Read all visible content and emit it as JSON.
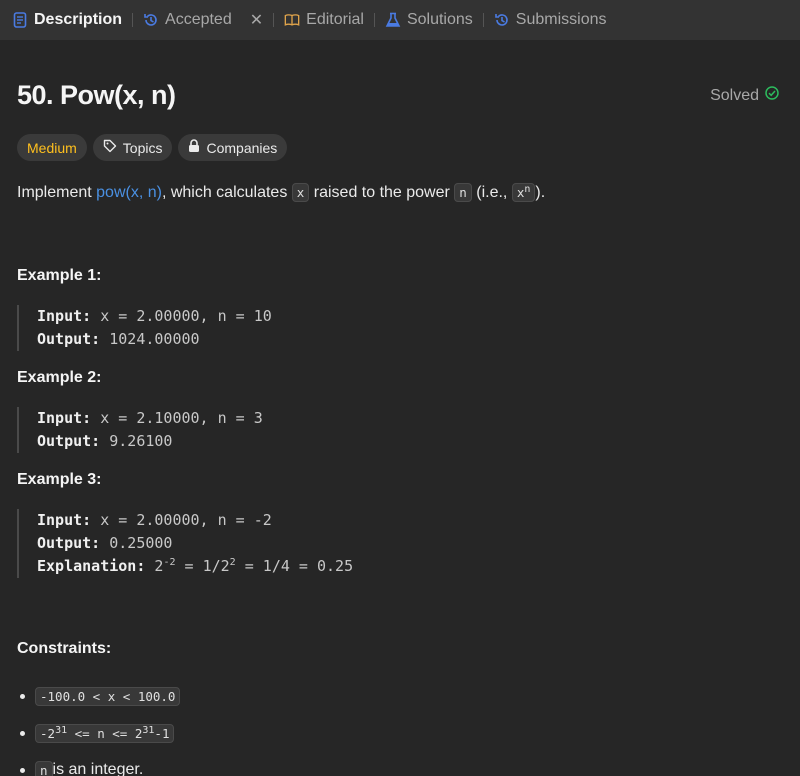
{
  "tabs": {
    "description": "Description",
    "accepted": "Accepted",
    "editorial": "Editorial",
    "solutions": "Solutions",
    "submissions": "Submissions"
  },
  "problem": {
    "title": "50. Pow(x, n)",
    "status": "Solved",
    "difficulty": "Medium",
    "topics_label": "Topics",
    "companies_label": "Companies"
  },
  "description": {
    "prefix": "Implement ",
    "link": "pow(x, n)",
    "mid1": ", which calculates ",
    "code_x": "x",
    "mid2": " raised to the power ",
    "code_n": "n",
    "mid3": " (i.e., ",
    "code_xn_base": "x",
    "code_xn_exp": "n",
    "suffix": ")."
  },
  "examples": [
    {
      "title": "Example 1:",
      "input_label": "Input:",
      "input": "x = 2.00000, n = 10",
      "output_label": "Output:",
      "output": "1024.00000"
    },
    {
      "title": "Example 2:",
      "input_label": "Input:",
      "input": "x = 2.10000, n = 3",
      "output_label": "Output:",
      "output": "9.26100"
    },
    {
      "title": "Example 3:",
      "input_label": "Input:",
      "input": "x = 2.00000, n = -2",
      "output_label": "Output:",
      "output": "0.25000",
      "explanation_label": "Explanation:",
      "explanation_a": "2",
      "explanation_a_exp": "-2",
      "explanation_b": " = 1/2",
      "explanation_b_exp": "2",
      "explanation_c": " = 1/4 = 0.25"
    }
  ],
  "constraints": {
    "title": "Constraints:",
    "c1": "-100.0 < x < 100.0",
    "c2_a": "-2",
    "c2_a_exp": "31",
    "c2_b": " <= n <= 2",
    "c2_b_exp": "31",
    "c2_c": "-1",
    "c3_code": "n",
    "c3_text": " is an integer."
  },
  "colors": {
    "difficulty": "#ffc01e",
    "link": "#4a90e2",
    "solved_check": "#2cbb5d",
    "tab_icon_blue": "#4a7be2",
    "editorial_icon": "#e0a44b"
  }
}
